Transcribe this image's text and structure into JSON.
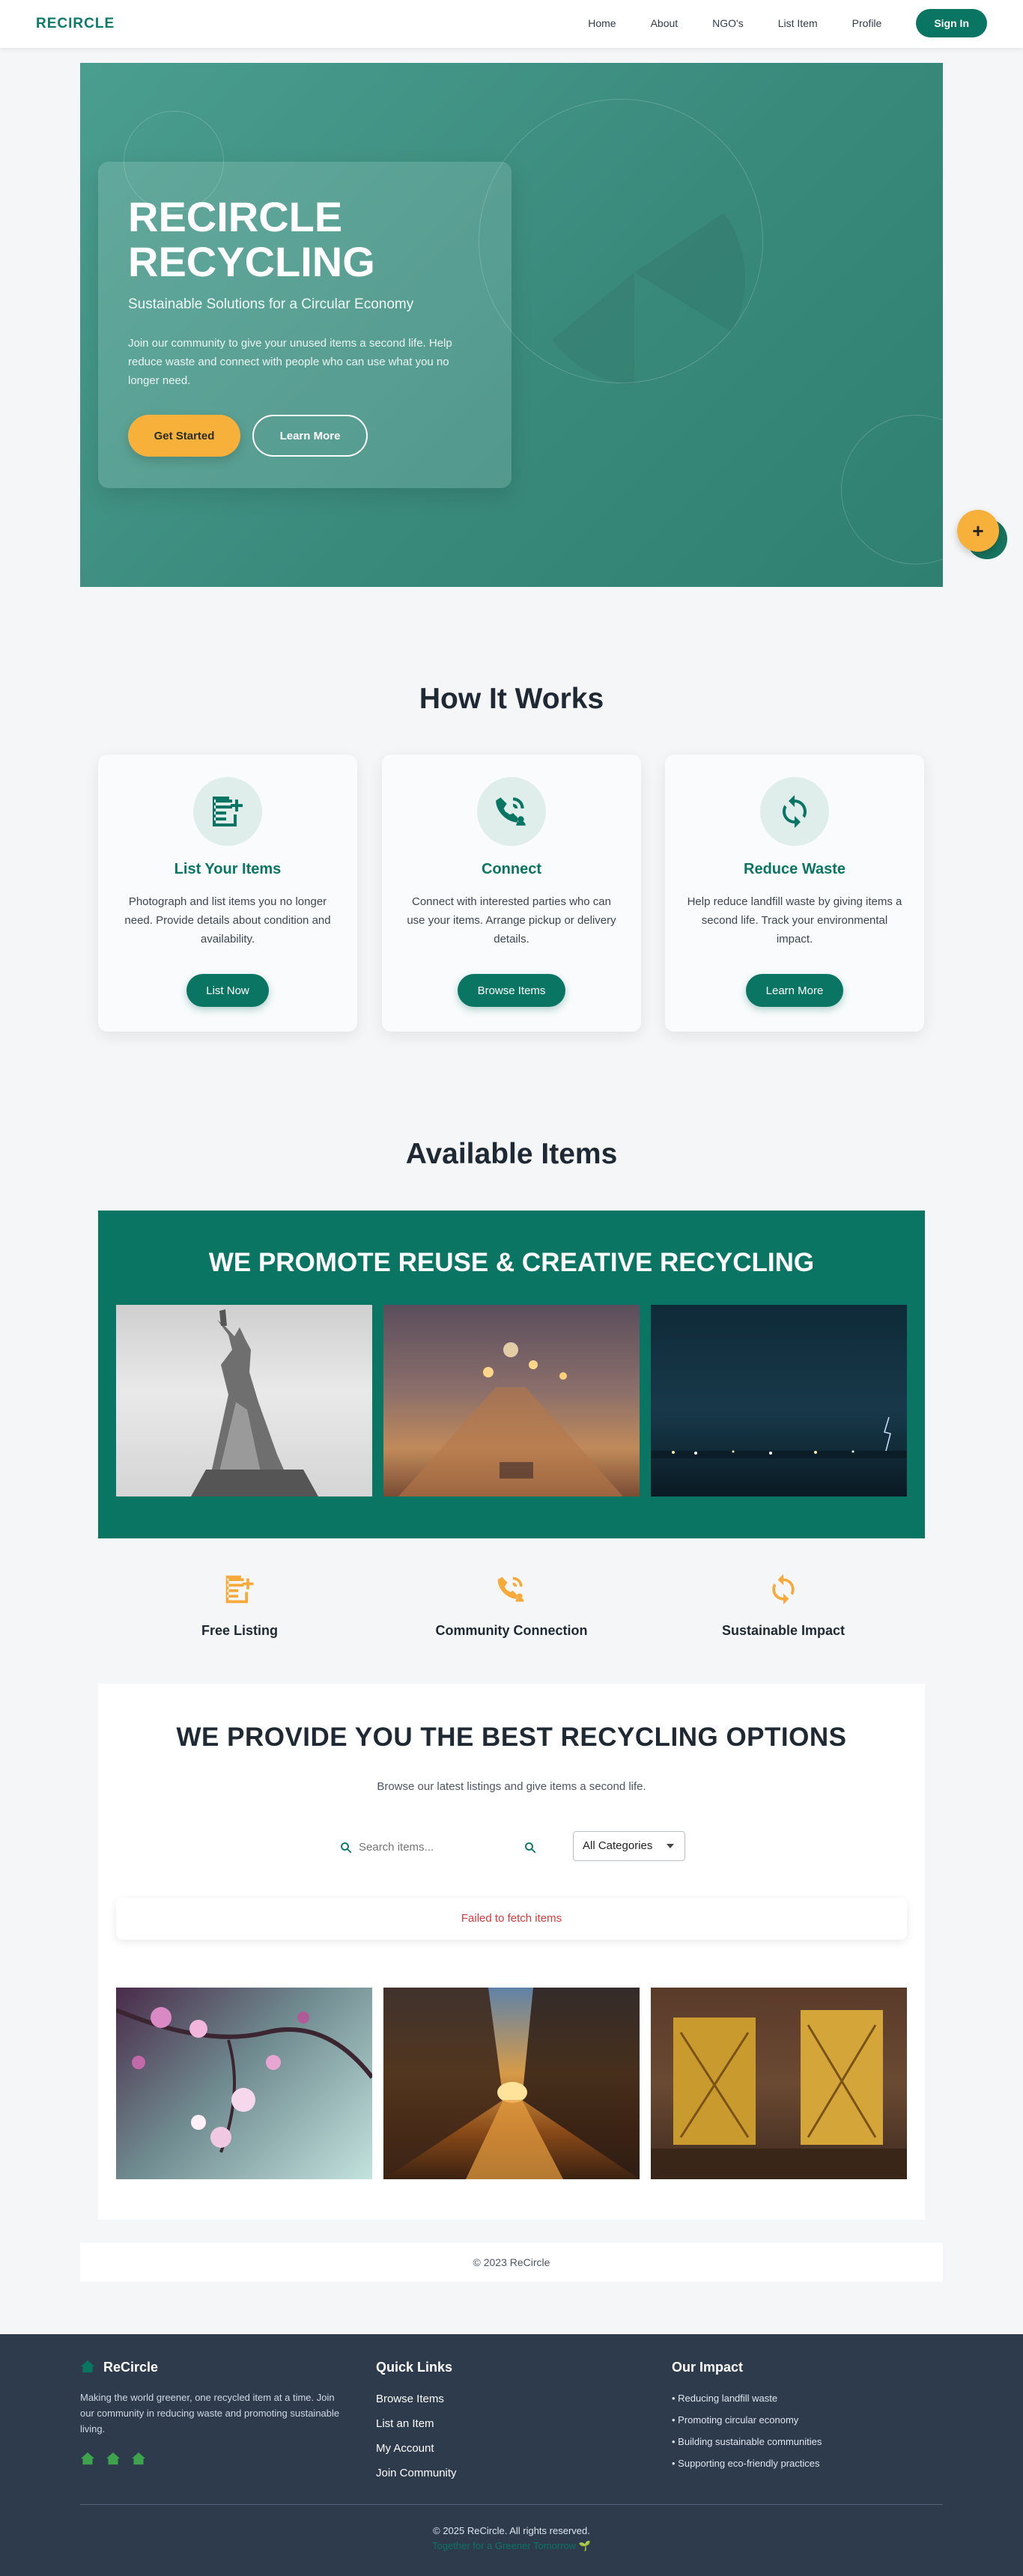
{
  "nav": {
    "brand": "RECIRCLE",
    "links": [
      "Home",
      "About",
      "NGO's",
      "List Item",
      "Profile"
    ],
    "signin": "Sign In"
  },
  "hero": {
    "title": "RECIRCLE RECYCLING",
    "subtitle": "Sustainable Solutions for a Circular Economy",
    "text": "Join our community to give your unused items a second life. Help reduce waste and connect with people who can use what you no longer need.",
    "primary_btn": "Get Started",
    "secondary_btn": "Learn More",
    "fab": "+"
  },
  "how": {
    "title": "How It Works",
    "cards": [
      {
        "icon": "list-add-icon",
        "title": "List Your Items",
        "desc": "Photograph and list items you no longer need. Provide details about condition and availability.",
        "btn": "List Now"
      },
      {
        "icon": "connect-icon",
        "title": "Connect",
        "desc": "Connect with interested parties who can use your items. Arrange pickup or delivery details.",
        "btn": "Browse Items"
      },
      {
        "icon": "recycle-icon",
        "title": "Reduce Waste",
        "desc": "Help reduce landfill waste by giving items a second life. Track your environmental impact.",
        "btn": "Learn More"
      }
    ]
  },
  "available": {
    "title": "Available Items",
    "promo_title": "WE PROMOTE REUSE & CREATIVE RECYCLING",
    "features": [
      "Free Listing",
      "Community Connection",
      "Sustainable Impact"
    ]
  },
  "options": {
    "title": "WE PROVIDE YOU THE BEST RECYCLING OPTIONS",
    "subtitle": "Browse our latest listings and give items a second life.",
    "search_placeholder": "Search items...",
    "category": "All Categories",
    "error": "Failed to fetch items"
  },
  "copyright_bar": "© 2023 ReCircle",
  "footer": {
    "brand": "ReCircle",
    "about": "Making the world greener, one recycled item at a time. Join our community in reducing waste and promoting sustainable living.",
    "quick_title": "Quick Links",
    "quick_links": [
      "Browse Items",
      "List an Item",
      "My Account",
      "Join Community"
    ],
    "impact_title": "Our Impact",
    "impact": [
      "• Reducing landfill waste",
      "• Promoting circular economy",
      "• Building sustainable communities",
      "• Supporting eco-friendly practices"
    ],
    "copyright": "© 2025 ReCircle. All rights reserved.",
    "tagline": "Together for a Greener Tomorrow 🌱"
  },
  "colors": {
    "primary": "#0b7563",
    "accent": "#f7b03a",
    "footer": "#2d3b4d",
    "error": "#d63a3a"
  }
}
